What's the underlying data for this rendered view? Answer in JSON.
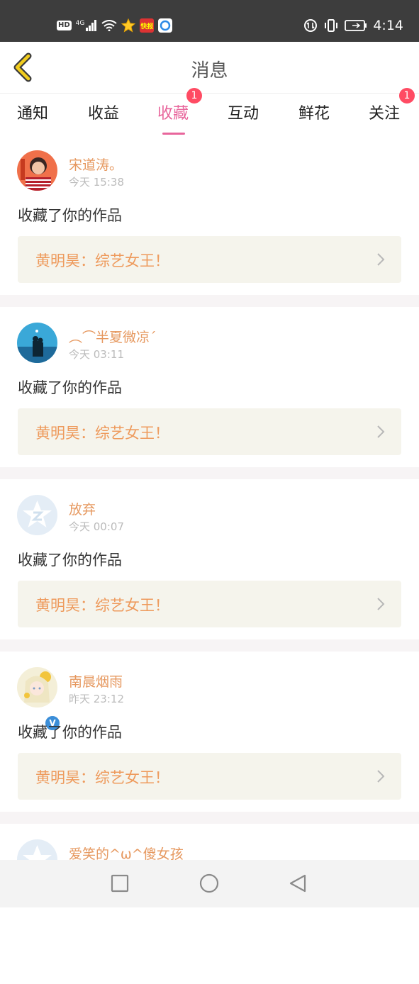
{
  "status_bar": {
    "left_icons": [
      "hd-icon",
      "4g-signal-icon",
      "wifi-icon",
      "star-app-icon",
      "news-app-icon",
      "q-app-icon"
    ],
    "hd_label": "HD",
    "net_label": "4G",
    "news_app_label": "快报",
    "right_icons": [
      "data-saver-icon",
      "vibrate-icon",
      "battery-icon"
    ],
    "time": "4:14"
  },
  "header": {
    "title": "消息",
    "back_icon": "chevron-left-icon"
  },
  "tabs": [
    {
      "label": "通知",
      "badge": ""
    },
    {
      "label": "收益",
      "badge": ""
    },
    {
      "label": "收藏",
      "badge": "1",
      "active": true
    },
    {
      "label": "互动",
      "badge": ""
    },
    {
      "label": "鲜花",
      "badge": ""
    },
    {
      "label": "关注",
      "badge": "1"
    }
  ],
  "messages": [
    {
      "username": "宋道涛。",
      "time": "今天 15:38",
      "action": "收藏了你的作品",
      "work": "黄明昊：综艺女王！",
      "avatar": "photo-avatar",
      "verified": false
    },
    {
      "username": "︵⌒半夏微凉´",
      "time": "今天 03:11",
      "action": "收藏了你的作品",
      "work": "黄明昊：综艺女王！",
      "avatar": "silhouette-avatar",
      "verified": false
    },
    {
      "username": "放弃",
      "time": "今天 00:07",
      "action": "收藏了你的作品",
      "work": "黄明昊：综艺女王！",
      "avatar": "default-avatar",
      "verified": false
    },
    {
      "username": "南晨烟雨",
      "time": "昨天 23:12",
      "action": "收藏了你的作品",
      "work": "黄明昊：综艺女王！",
      "avatar": "anime-avatar",
      "verified": true
    },
    {
      "username": "爱笑的^ω^傻女孩",
      "time": "",
      "action": "",
      "work": "",
      "avatar": "default-avatar",
      "verified": false
    }
  ],
  "nav_bar": {
    "buttons": [
      "recents-square-icon",
      "home-circle-icon",
      "back-triangle-icon"
    ]
  },
  "colors": {
    "accent": "#e8669c",
    "badge": "#ff4b63",
    "username": "#e6985f",
    "work_title": "#ee9a5c",
    "work_bg": "#f5f4ec",
    "separator": "#f7f4f5"
  }
}
